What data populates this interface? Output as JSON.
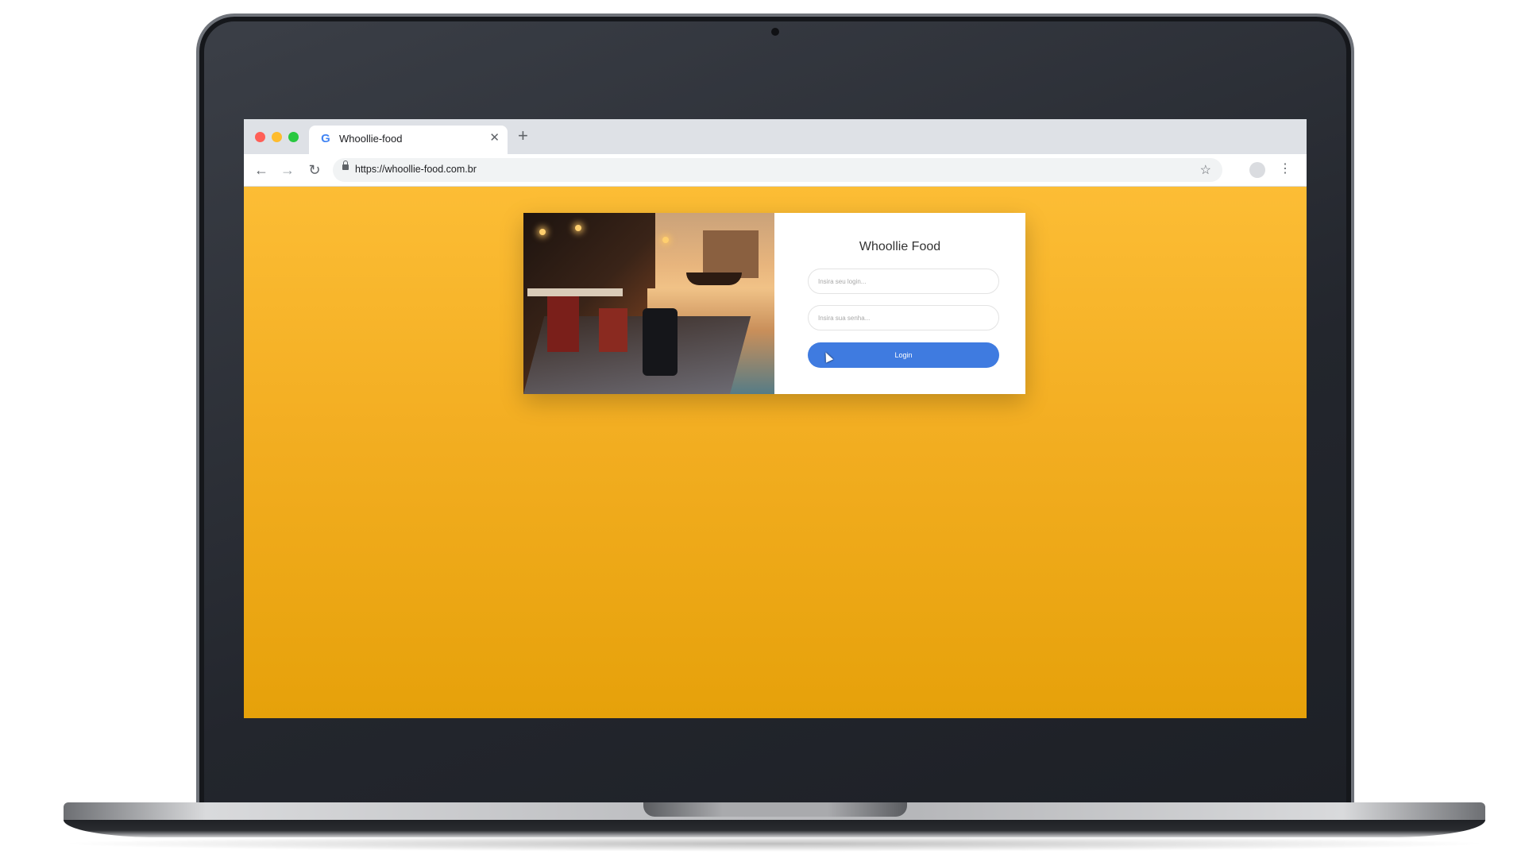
{
  "browser": {
    "tab_title": "Whoollie-food",
    "tab_favicon": "G",
    "url": "https://whoollie-food.com.br"
  },
  "icons": {
    "back": "back-arrow-icon",
    "forward": "forward-arrow-icon",
    "reload": "reload-icon",
    "lock": "lock-icon",
    "star": "star-icon",
    "menu": "more-vert-icon",
    "close": "close-icon",
    "new_tab": "plus-icon",
    "profile": "profile-avatar-icon"
  },
  "login": {
    "title": "Whoollie Food",
    "login_placeholder": "Insira seu login...",
    "password_placeholder": "Insira sua senha...",
    "button_label": "Login"
  },
  "colors": {
    "background_top": "#fcbd35",
    "background_bottom": "#e6a10a",
    "button": "#3f7be0"
  }
}
